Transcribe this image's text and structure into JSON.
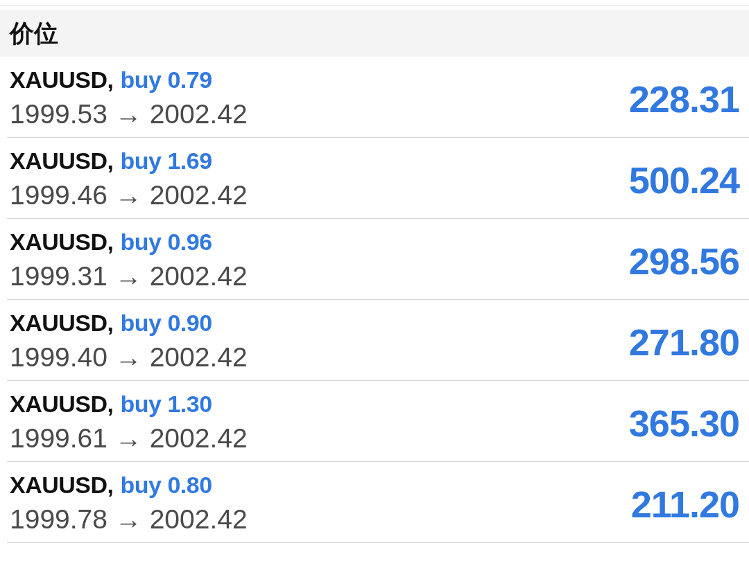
{
  "section_header": "价位",
  "positions": [
    {
      "symbol": "XAUUSD,",
      "order": "buy 0.79",
      "prices": "1999.53 → 2002.42",
      "profit": "228.31"
    },
    {
      "symbol": "XAUUSD,",
      "order": "buy 1.69",
      "prices": "1999.46 → 2002.42",
      "profit": "500.24"
    },
    {
      "symbol": "XAUUSD,",
      "order": "buy 0.96",
      "prices": "1999.31 → 2002.42",
      "profit": "298.56"
    },
    {
      "symbol": "XAUUSD,",
      "order": "buy 0.90",
      "prices": "1999.40 → 2002.42",
      "profit": "271.80"
    },
    {
      "symbol": "XAUUSD,",
      "order": "buy 1.30",
      "prices": "1999.61 → 2002.42",
      "profit": "365.30"
    },
    {
      "symbol": "XAUUSD,",
      "order": "buy 0.80",
      "prices": "1999.78 → 2002.42",
      "profit": "211.20"
    }
  ]
}
